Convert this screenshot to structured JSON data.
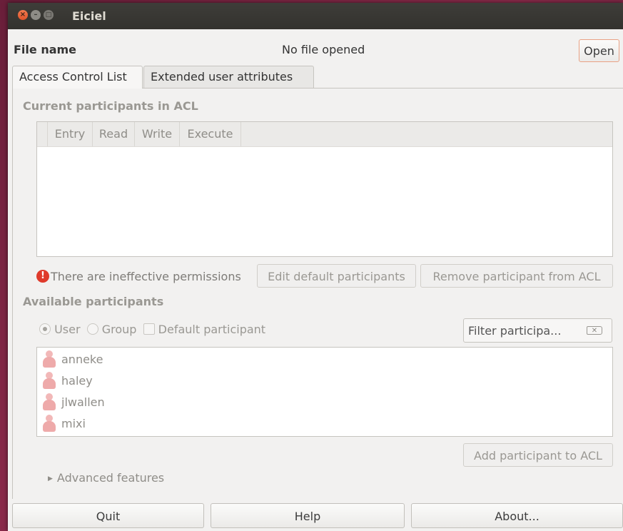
{
  "window": {
    "title": "Eiciel"
  },
  "file": {
    "label": "File name",
    "value": "No file opened",
    "open_label": "Open"
  },
  "tabs": [
    {
      "label": "Access Control List",
      "active": true
    },
    {
      "label": "Extended user attributes",
      "active": false
    }
  ],
  "acl": {
    "section_title": "Current participants in ACL",
    "columns": [
      "Entry",
      "Read",
      "Write",
      "Execute"
    ],
    "rows": [],
    "warning_text": "There are ineffective permissions",
    "edit_default_label": "Edit default participants",
    "remove_label": "Remove participant from ACL"
  },
  "available": {
    "section_title": "Available participants",
    "radio_user": "User",
    "radio_group": "Group",
    "selected": "User",
    "default_participant": "Default participant",
    "filter_placeholder": "Filter participa...",
    "users": [
      "anneke",
      "haley",
      "jlwallen",
      "mixi"
    ],
    "add_label": "Add participant to ACL"
  },
  "advanced_label": "Advanced features",
  "footer": {
    "quit": "Quit",
    "help": "Help",
    "about": "About..."
  },
  "icons": {
    "close": "close-icon",
    "minimize": "minimize-icon",
    "maximize": "maximize-icon",
    "warning": "warning-icon",
    "user": "user-icon",
    "clear": "clear-icon",
    "expander": "expander-triangle-icon"
  },
  "colors": {
    "accent": "#e0542a",
    "warning": "#df3a2b",
    "titlebar": "#3c3b37"
  }
}
